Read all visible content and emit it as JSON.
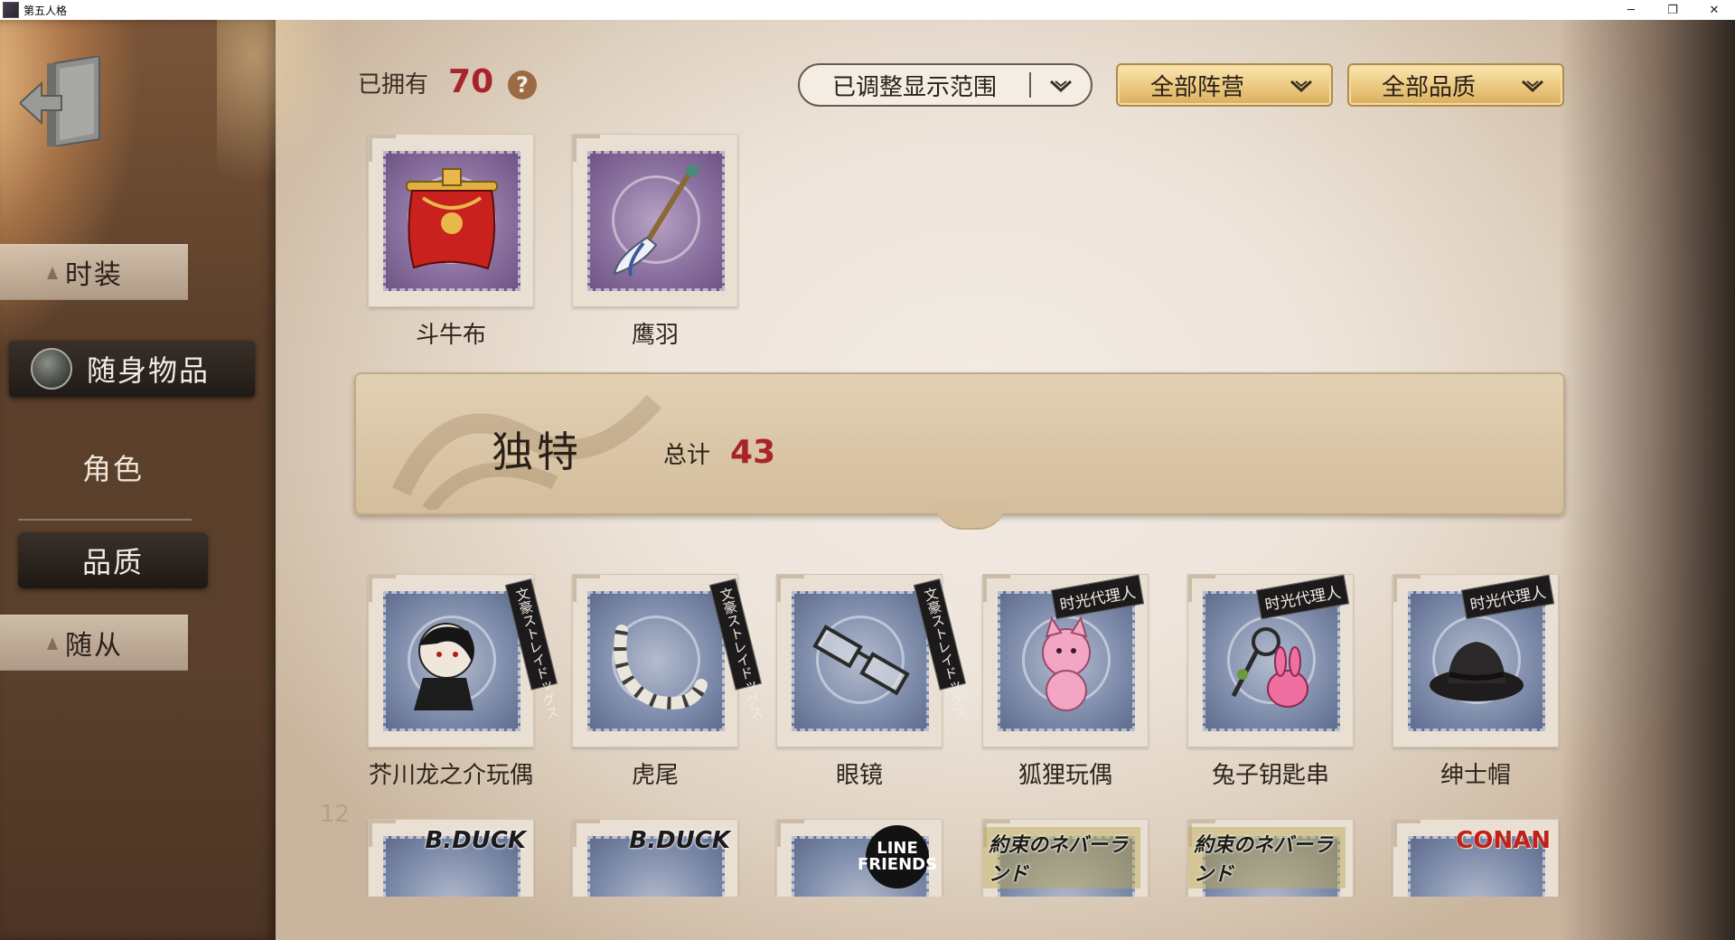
{
  "window": {
    "title": "第五人格",
    "controls": [
      "─",
      "❐",
      "✕"
    ]
  },
  "sidebar": {
    "exit_icon": "exit-door-icon",
    "tabs": [
      {
        "label": "时装"
      },
      {
        "label": "随身物品",
        "icon": "shield-emblem-icon"
      },
      {
        "label": "随从"
      }
    ],
    "filters": [
      {
        "label": "角色"
      },
      {
        "label": "品质"
      }
    ]
  },
  "header": {
    "owned_label": "已拥有",
    "owned_count": "70",
    "help_icon_glyph": "?",
    "dropdowns": [
      {
        "value": "已调整显示范围"
      },
      {
        "value": "全部阵营"
      },
      {
        "value": "全部品质"
      }
    ]
  },
  "top_items": [
    {
      "name": "斗牛布",
      "frame": "purple",
      "icon": "red-cape-icon"
    },
    {
      "name": "鹰羽",
      "frame": "purple",
      "icon": "eagle-feather-icon"
    }
  ],
  "section": {
    "title": "独特",
    "total_label": "总计",
    "total_count": "43"
  },
  "unique_items": [
    {
      "name": "芥川龙之介玩偶",
      "tag": "文豪ストレイドッグス",
      "icon": "plush-doll-icon"
    },
    {
      "name": "虎尾",
      "tag": "文豪ストレイドッグス",
      "icon": "tiger-tail-icon"
    },
    {
      "name": "眼镜",
      "tag": "文豪ストレイドッグス",
      "icon": "glasses-icon"
    },
    {
      "name": "狐狸玩偶",
      "tag": "时光代理人",
      "icon": "pink-fox-plush-icon"
    },
    {
      "name": "兔子钥匙串",
      "tag": "时光代理人",
      "icon": "bunny-keychain-icon"
    },
    {
      "name": "绅士帽",
      "tag": "时光代理人",
      "icon": "black-fedora-icon"
    }
  ],
  "partial_items": [
    {
      "brand": "B.DUCK"
    },
    {
      "brand": "B.DUCK"
    },
    {
      "brand": "LINE FRIENDS"
    },
    {
      "brand": "約束のネバーランド"
    },
    {
      "brand": "約束のネバーランド"
    },
    {
      "brand": "CONAN"
    }
  ],
  "background_number": "12",
  "colors": {
    "accent_red": "#a8242a",
    "gold_dropdown": "#e9c57a",
    "purple_frame": "#8c72a0",
    "blue_frame": "#8290ae",
    "dark_tab": "#2a221c"
  }
}
